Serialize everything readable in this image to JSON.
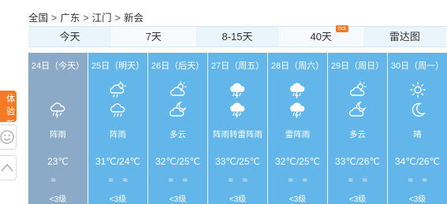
{
  "breadcrumb": {
    "items": [
      "全国",
      "广东",
      "江门",
      "新会"
    ],
    "separator": ">"
  },
  "tabs": [
    {
      "label": "今天"
    },
    {
      "label": "7天"
    },
    {
      "label": "8-15天"
    },
    {
      "label": "40天",
      "badge": "hot"
    },
    {
      "label": "雷达图"
    }
  ],
  "active_tab": "7天",
  "side_panel": {
    "feedback_label_line1": "体验",
    "feedback_label_line2": "新版",
    "emoji_icon": "smile-icon",
    "up_icon": "chevron-up-icon"
  },
  "colors": {
    "tab_bar": "#eaf4fb",
    "today_column": "#8aaac8",
    "forecast_column": "#62b6ea",
    "accent": "#f47a25"
  },
  "days": [
    {
      "date": "24日（今天）",
      "icon_day": "",
      "icon_night": "cloud-rain-thunder-icon",
      "desc": "阵雨",
      "temp": "23℃",
      "wind": [
        "≈",
        ""
      ],
      "level": "<3级"
    },
    {
      "date": "25日（明天）",
      "icon_day": "sun-cloud-rain-icon",
      "icon_night": "cloud-rain-icon",
      "desc": "阵雨",
      "temp": "31℃/24℃",
      "wind": [
        "≈",
        "≈"
      ],
      "level": "<3级"
    },
    {
      "date": "26日（后天）",
      "icon_day": "sun-cloud-icon",
      "icon_night": "moon-cloud-icon",
      "desc": "多云",
      "temp": "32℃/25℃",
      "wind": [
        "≈",
        "≈"
      ],
      "level": "<3级"
    },
    {
      "date": "27日（周五）",
      "icon_day": "thunder-rain-icon",
      "icon_night": "thunder-rain-icon",
      "desc": "阵雨转雷阵雨",
      "temp": "33℃/25℃",
      "wind": [
        "≈",
        "≈"
      ],
      "level": "<3级"
    },
    {
      "date": "28日（周六）",
      "icon_day": "thunder-rain-icon",
      "icon_night": "thunder-rain-icon",
      "desc": "雷阵雨",
      "temp": "32℃/25℃",
      "wind": [
        "≈",
        "≈"
      ],
      "level": "<3级"
    },
    {
      "date": "29日（周日）",
      "icon_day": "sun-cloud-icon",
      "icon_night": "moon-cloud-icon",
      "desc": "多云",
      "temp": "33℃/26℃",
      "wind": [
        "≈",
        "≈"
      ],
      "level": "<3级"
    },
    {
      "date": "30日（周一）",
      "icon_day": "sun-icon",
      "icon_night": "moon-icon",
      "desc": "晴",
      "temp": "34℃/26℃",
      "wind": [
        "≈",
        "≈"
      ],
      "level": "<3级"
    }
  ]
}
